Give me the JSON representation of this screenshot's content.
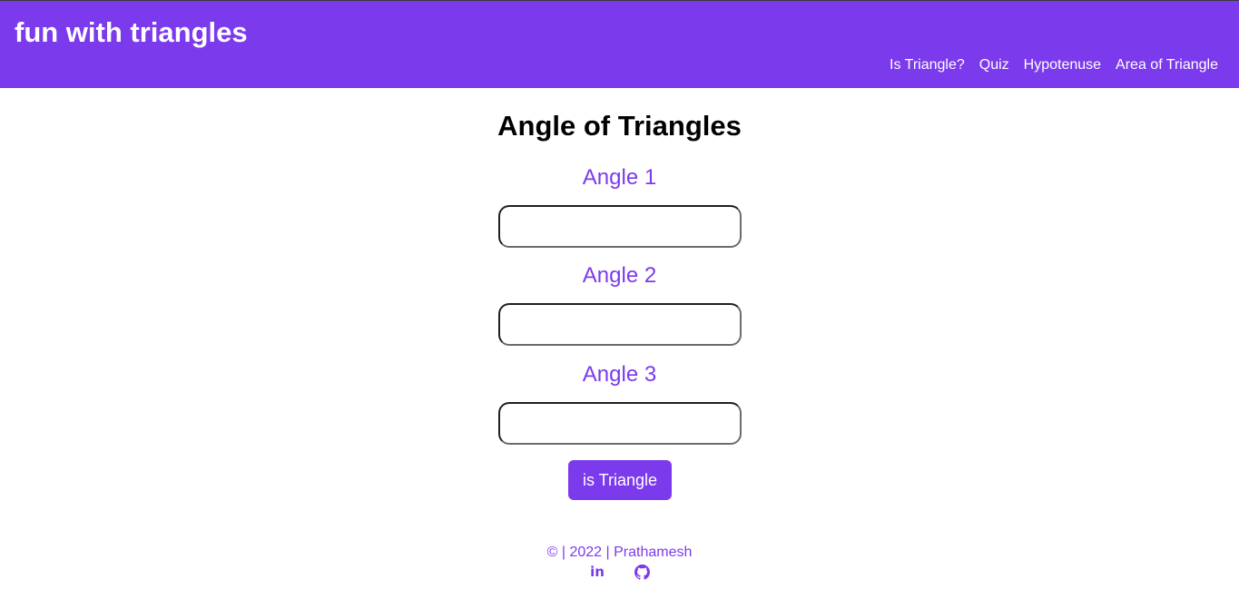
{
  "header": {
    "brand": "fun with triangles",
    "nav": [
      {
        "label": "Is Triangle?"
      },
      {
        "label": "Quiz"
      },
      {
        "label": "Hypotenuse"
      },
      {
        "label": "Area of Triangle"
      }
    ]
  },
  "main": {
    "title": "Angle of Triangles",
    "angles": [
      {
        "label": "Angle 1",
        "value": ""
      },
      {
        "label": "Angle 2",
        "value": ""
      },
      {
        "label": "Angle 3",
        "value": ""
      }
    ],
    "button_label": "is Triangle"
  },
  "footer": {
    "text": "© | 2022 | Prathamesh",
    "social": [
      {
        "icon": "linkedin-icon",
        "glyph": "in"
      },
      {
        "icon": "github-icon"
      }
    ]
  },
  "colors": {
    "accent": "#7c3aed",
    "header_text": "#ffffff",
    "title": "#000000"
  }
}
